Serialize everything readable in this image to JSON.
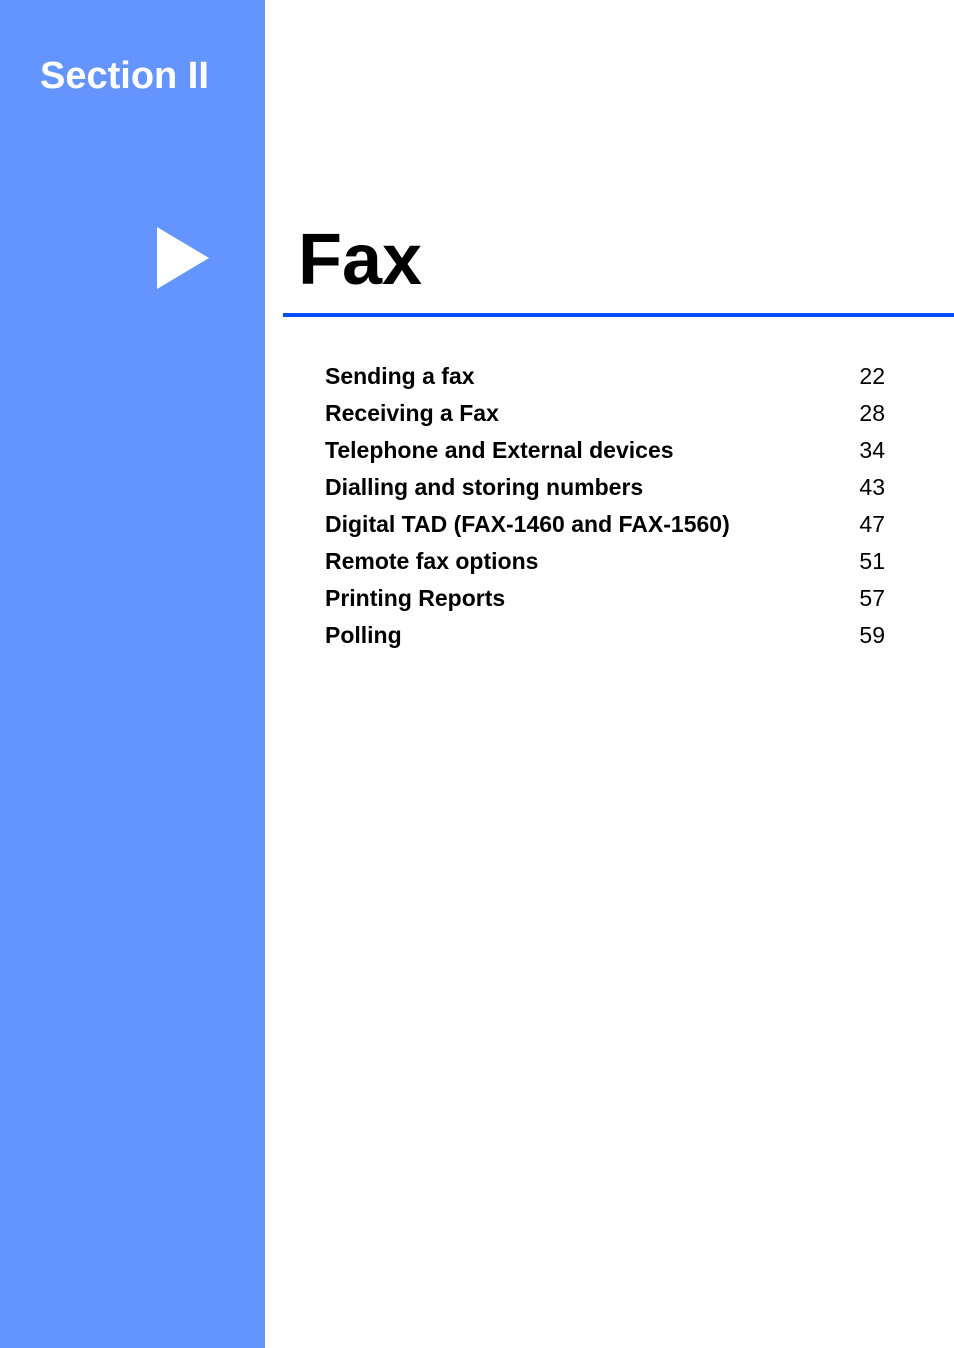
{
  "sidebar": {
    "section_label": "Section II",
    "color": "#6495ff",
    "marker_icon": "triangle-right-icon"
  },
  "chapter": {
    "title": "Fax",
    "rule_color": "#0050ff"
  },
  "toc": {
    "entries": [
      {
        "label": "Sending a fax",
        "page": "22"
      },
      {
        "label": "Receiving a Fax",
        "page": "28"
      },
      {
        "label": "Telephone and External devices",
        "page": "34"
      },
      {
        "label": "Dialling and storing numbers",
        "page": "43"
      },
      {
        "label": "Digital TAD (FAX-1460 and FAX-1560)",
        "page": "47"
      },
      {
        "label": "Remote fax options",
        "page": "51"
      },
      {
        "label": "Printing Reports",
        "page": "57"
      },
      {
        "label": "Polling",
        "page": "59"
      }
    ]
  }
}
